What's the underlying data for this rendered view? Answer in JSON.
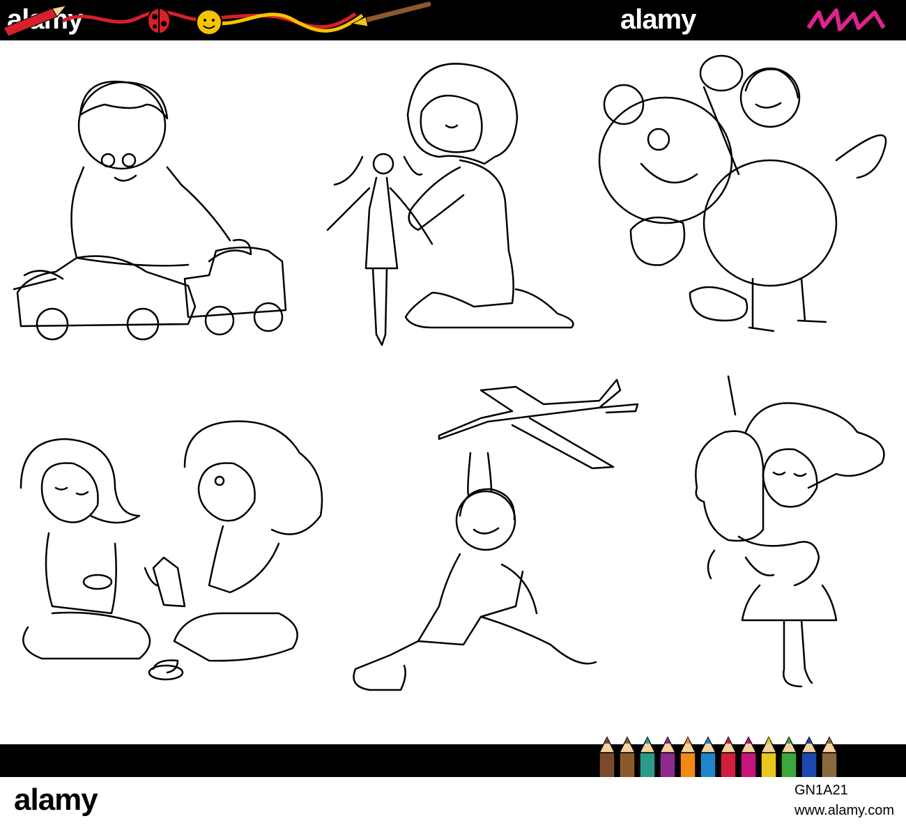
{
  "watermarks": {
    "top_left": "alamy",
    "top_right": "alamy"
  },
  "footer": {
    "logo": "alamy",
    "image_id": "GN1A21",
    "site": "www.alamy.com"
  },
  "colors": {
    "bar": "#000000",
    "accent_magenta": "#e0248c",
    "sun": "#f5c400",
    "ladybug": "#d6202a"
  },
  "pencil_colors": [
    "#7a4a2a",
    "#8b5a2b",
    "#2a9a8a",
    "#8e2a8e",
    "#f08a10",
    "#1e86c8",
    "#d01e3c",
    "#c8147a",
    "#e8c81a",
    "#3aa83a",
    "#1a4ab0",
    "#8a6a3a"
  ],
  "scenes": [
    {
      "id": "boy-toy-cars"
    },
    {
      "id": "girl-with-doll"
    },
    {
      "id": "boy-hugging-teddy-bear"
    },
    {
      "id": "girls-tea-party"
    },
    {
      "id": "boy-with-toy-plane"
    },
    {
      "id": "girl-hugging-unicorn"
    }
  ]
}
